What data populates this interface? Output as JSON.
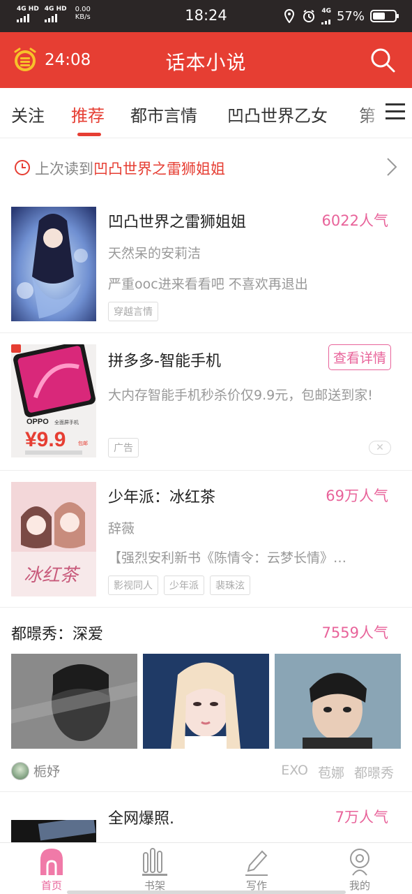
{
  "status_bar": {
    "network1": "4G HD",
    "network2": "4G HD",
    "speed_value": "0.00",
    "speed_unit": "KB/s",
    "time": "18:24",
    "network3": "4G",
    "battery": "57%",
    "battery_level": 0.57
  },
  "app_bar": {
    "timer": "24:08",
    "title": "话本小说"
  },
  "tabs": [
    "关注",
    "推荐",
    "都市言情",
    "凹凸世界乙女",
    "第"
  ],
  "last_read": {
    "prefix": "上次读到",
    "title": "凹凸世界之雷狮姐姐"
  },
  "books": [
    {
      "title": "凹凸世界之雷狮姐姐",
      "popularity": "6022人气",
      "author": "天然呆的安莉洁",
      "desc": "严重ooc进来看看吧 不喜欢再退出",
      "tags": [
        "穿越言情"
      ]
    },
    {
      "title": "少年派：冰红茶",
      "popularity": "69万人气",
      "author": "辞薇",
      "desc": "【强烈安利新书《陈情令：云梦长情》…",
      "tags": [
        "影视同人",
        "少年派",
        "裴珠泫"
      ]
    }
  ],
  "ad": {
    "title": "拼多多-智能手机",
    "button": "查看详情",
    "desc": "大内存智能手机秒杀价仅9.9元，包邮送到家!",
    "tag": "广告",
    "cover_brand": "OPPO",
    "cover_caption": "全面屏手机",
    "cover_price": "¥9.9",
    "cover_suffix": "包邮"
  },
  "feature": {
    "title": "都暻秀：深爱",
    "popularity": "7559人气",
    "author": "栀妤",
    "tags": [
      "EXO",
      "苞娜",
      "都暻秀"
    ]
  },
  "next_book": {
    "title": "全网爆照.",
    "popularity": "7万人气"
  },
  "bottom_nav": [
    "首页",
    "书架",
    "写作",
    "我的"
  ],
  "colors": {
    "primary_red": "#e63e33",
    "popularity_pink": "#e8639a",
    "status_bar": "#2b2626"
  }
}
